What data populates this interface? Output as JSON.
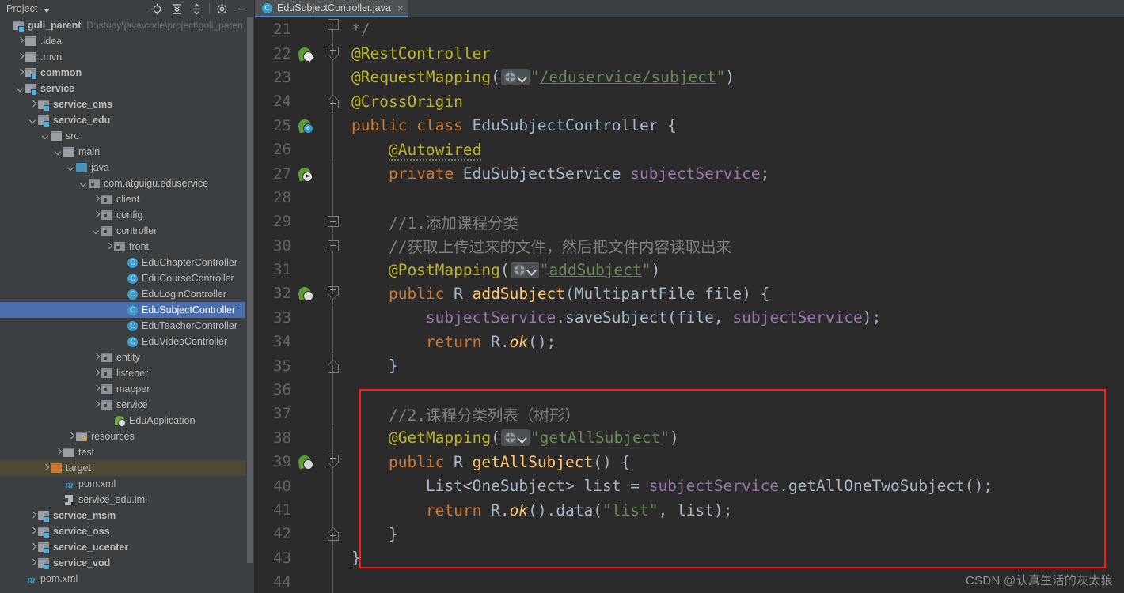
{
  "panel": {
    "title": "Project",
    "toolbar": [
      {
        "name": "locate-icon",
        "label": "Select Opened File"
      },
      {
        "name": "expand-all-icon",
        "label": "Expand All"
      },
      {
        "name": "collapse-all-icon",
        "label": "Collapse All"
      },
      {
        "name": "gear-icon",
        "label": "Settings"
      },
      {
        "name": "minimize-icon",
        "label": "Hide"
      }
    ],
    "tree": [
      {
        "label": "guli_parent",
        "path": "D:\\study\\java\\code\\project\\guli_paren",
        "indent": 0,
        "arrow": "none",
        "icon": "module",
        "bold": true,
        "state": "normal"
      },
      {
        "label": ".idea",
        "indent": 1,
        "arrow": "right",
        "icon": "folder",
        "bold": false,
        "state": "normal"
      },
      {
        "label": ".mvn",
        "indent": 1,
        "arrow": "right",
        "icon": "folder",
        "bold": false,
        "state": "normal"
      },
      {
        "label": "common",
        "indent": 1,
        "arrow": "right",
        "icon": "module",
        "bold": true,
        "state": "normal"
      },
      {
        "label": "service",
        "indent": 1,
        "arrow": "down",
        "icon": "module",
        "bold": true,
        "state": "normal"
      },
      {
        "label": "service_cms",
        "indent": 2,
        "arrow": "right",
        "icon": "module",
        "bold": true,
        "state": "normal"
      },
      {
        "label": "service_edu",
        "indent": 2,
        "arrow": "down",
        "icon": "module",
        "bold": true,
        "state": "normal"
      },
      {
        "label": "src",
        "indent": 3,
        "arrow": "down",
        "icon": "src",
        "bold": false,
        "state": "normal"
      },
      {
        "label": "main",
        "indent": 4,
        "arrow": "down",
        "icon": "folder",
        "bold": false,
        "state": "normal"
      },
      {
        "label": "java",
        "indent": 5,
        "arrow": "down",
        "icon": "javafolder",
        "bold": false,
        "state": "normal"
      },
      {
        "label": "com.atguigu.eduservice",
        "indent": 6,
        "arrow": "down",
        "icon": "pkg",
        "bold": false,
        "state": "normal"
      },
      {
        "label": "client",
        "indent": 7,
        "arrow": "right",
        "icon": "pkg",
        "bold": false,
        "state": "normal"
      },
      {
        "label": "config",
        "indent": 7,
        "arrow": "right",
        "icon": "pkg",
        "bold": false,
        "state": "normal"
      },
      {
        "label": "controller",
        "indent": 7,
        "arrow": "down",
        "icon": "pkg",
        "bold": false,
        "state": "normal"
      },
      {
        "label": "front",
        "indent": 8,
        "arrow": "right",
        "icon": "pkg",
        "bold": false,
        "state": "normal"
      },
      {
        "label": "EduChapterController",
        "indent": 9,
        "arrow": "none",
        "icon": "class",
        "bold": false,
        "state": "normal"
      },
      {
        "label": "EduCourseController",
        "indent": 9,
        "arrow": "none",
        "icon": "class",
        "bold": false,
        "state": "normal"
      },
      {
        "label": "EduLoginController",
        "indent": 9,
        "arrow": "none",
        "icon": "class",
        "bold": false,
        "state": "normal"
      },
      {
        "label": "EduSubjectController",
        "indent": 9,
        "arrow": "none",
        "icon": "class",
        "bold": false,
        "state": "selected"
      },
      {
        "label": "EduTeacherController",
        "indent": 9,
        "arrow": "none",
        "icon": "class",
        "bold": false,
        "state": "normal"
      },
      {
        "label": "EduVideoController",
        "indent": 9,
        "arrow": "none",
        "icon": "class",
        "bold": false,
        "state": "normal"
      },
      {
        "label": "entity",
        "indent": 7,
        "arrow": "right",
        "icon": "pkg",
        "bold": false,
        "state": "normal"
      },
      {
        "label": "listener",
        "indent": 7,
        "arrow": "right",
        "icon": "pkg",
        "bold": false,
        "state": "normal"
      },
      {
        "label": "mapper",
        "indent": 7,
        "arrow": "right",
        "icon": "pkg",
        "bold": false,
        "state": "normal"
      },
      {
        "label": "service",
        "indent": 7,
        "arrow": "right",
        "icon": "pkg",
        "bold": false,
        "state": "normal"
      },
      {
        "label": "EduApplication",
        "indent": 8,
        "arrow": "none",
        "icon": "spring",
        "bold": false,
        "state": "normal"
      },
      {
        "label": "resources",
        "indent": 5,
        "arrow": "right",
        "icon": "res",
        "bold": false,
        "state": "normal"
      },
      {
        "label": "test",
        "indent": 4,
        "arrow": "right",
        "icon": "folder",
        "bold": false,
        "state": "normal"
      },
      {
        "label": "target",
        "indent": 3,
        "arrow": "right",
        "icon": "target",
        "bold": false,
        "state": "highlighted"
      },
      {
        "label": "pom.xml",
        "indent": 4,
        "arrow": "none",
        "icon": "maven",
        "bold": false,
        "state": "normal"
      },
      {
        "label": "service_edu.iml",
        "indent": 4,
        "arrow": "none",
        "icon": "iml",
        "bold": false,
        "state": "normal"
      },
      {
        "label": "service_msm",
        "indent": 2,
        "arrow": "right",
        "icon": "module",
        "bold": true,
        "state": "normal"
      },
      {
        "label": "service_oss",
        "indent": 2,
        "arrow": "right",
        "icon": "module",
        "bold": true,
        "state": "normal"
      },
      {
        "label": "service_ucenter",
        "indent": 2,
        "arrow": "right",
        "icon": "module",
        "bold": true,
        "state": "normal"
      },
      {
        "label": "service_vod",
        "indent": 2,
        "arrow": "right",
        "icon": "module",
        "bold": true,
        "state": "normal"
      },
      {
        "label": "pom.xml",
        "indent": 1,
        "arrow": "none",
        "icon": "maven",
        "bold": false,
        "state": "normal"
      }
    ]
  },
  "editor": {
    "tab": {
      "label": "EduSubjectController.java",
      "close": "×",
      "icon": "java-class-icon"
    },
    "lines": [
      {
        "no": "21",
        "gutter": "none",
        "fold": "fold-start-top",
        "html": "<span class=\"cmt\">*/</span>"
      },
      {
        "no": "22",
        "gutter": "bean-check",
        "fold": "fold-arrow-down",
        "html": "<span class=\"ann\">@RestController</span>"
      },
      {
        "no": "23",
        "gutter": "none",
        "fold": "none",
        "html": "<span class=\"ann\">@RequestMapping</span><span class=\"punc\">(</span><WEB><span class=\"str\">\"</span><span class=\"ul-link\">/eduservice/subject</span><span class=\"str\">\"</span><span class=\"punc\">)</span>"
      },
      {
        "no": "24",
        "gutter": "none",
        "fold": "fold-arrow-up",
        "html": "<span class=\"ann\">@CrossOrigin</span>"
      },
      {
        "no": "25",
        "gutter": "bean-blue",
        "fold": "none",
        "html": "<span class=\"kw\">public class </span><span class=\"cls\">EduSubjectController </span><span class=\"punc\">{</span>"
      },
      {
        "no": "26",
        "gutter": "none",
        "fold": "none",
        "html": "    <span class=\"ann wavy\">@Autowired</span>"
      },
      {
        "no": "27",
        "gutter": "bean-arrow",
        "fold": "none",
        "html": "    <span class=\"kw\">private </span><span class=\"cls\">EduSubjectService </span><span class=\"field\">subjectService</span><span class=\"punc\">;</span>"
      },
      {
        "no": "28",
        "gutter": "none",
        "fold": "none",
        "html": ""
      },
      {
        "no": "29",
        "gutter": "none",
        "fold": "fold-box-small",
        "html": "    <span class=\"cmt\">//1.添加课程分类</span>"
      },
      {
        "no": "30",
        "gutter": "none",
        "fold": "fold-box-small",
        "html": "    <span class=\"cmt\">//获取上传过来的文件，然后把文件内容读取出来</span>"
      },
      {
        "no": "31",
        "gutter": "none",
        "fold": "none",
        "html": "    <span class=\"ann\">@PostMapping</span><span class=\"punc\">(</span><WEB><span class=\"str\">\"</span><span class=\"ul-link\">addSubject</span><span class=\"str\">\"</span><span class=\"punc\">)</span>"
      },
      {
        "no": "32",
        "gutter": "bean-web",
        "fold": "fold-arrow-down",
        "html": "    <span class=\"kw\">public </span><span class=\"cls\">R </span><span class=\"fn\">addSubject</span><span class=\"punc\">(</span><span class=\"cls\">MultipartFile </span><span class=\"punc\">file) {</span>"
      },
      {
        "no": "33",
        "gutter": "none",
        "fold": "none",
        "html": "        <span class=\"field\">subjectService</span><span class=\"punc\">.</span><span class=\"punc\">saveSubject(</span><span class=\"punc\">file, </span><span class=\"field\">subjectService</span><span class=\"punc\">);</span>"
      },
      {
        "no": "34",
        "gutter": "none",
        "fold": "none",
        "html": "        <span class=\"kw\">return </span><span class=\"cls\">R.</span><span class=\"fn ital\">ok</span><span class=\"punc\">();</span>"
      },
      {
        "no": "35",
        "gutter": "none",
        "fold": "fold-arrow-up",
        "html": "    <span class=\"punc\">}</span>"
      },
      {
        "no": "36",
        "gutter": "none",
        "fold": "none",
        "html": ""
      },
      {
        "no": "37",
        "gutter": "none",
        "fold": "none",
        "html": "    <span class=\"cmt\">//2.课程分类列表（树形）</span>"
      },
      {
        "no": "38",
        "gutter": "none",
        "fold": "none",
        "html": "    <span class=\"ann\">@GetMapping</span><span class=\"punc\">(</span><WEB><span class=\"str\">\"</span><span class=\"ul-link\">getAllSubject</span><span class=\"str\">\"</span><span class=\"punc\">)</span>"
      },
      {
        "no": "39",
        "gutter": "bean-web",
        "fold": "fold-arrow-down",
        "html": "    <span class=\"kw\">public </span><span class=\"cls\">R </span><span class=\"fn\">getAllSubject</span><span class=\"punc\">() {</span>"
      },
      {
        "no": "40",
        "gutter": "none",
        "fold": "none",
        "html": "        <span class=\"cls\">List&lt;OneSubject&gt; </span><span class=\"punc\">list = </span><span class=\"field\">subjectService</span><span class=\"punc\">.</span><span class=\"punc\">getAllOneTwoSubject();</span>"
      },
      {
        "no": "41",
        "gutter": "none",
        "fold": "none",
        "html": "        <span class=\"kw\">return </span><span class=\"cls\">R.</span><span class=\"fn ital\">ok</span><span class=\"punc\">().</span><span class=\"punc\">data(</span><span class=\"str\">\"list\"</span><span class=\"punc\">, list);</span>"
      },
      {
        "no": "42",
        "gutter": "none",
        "fold": "fold-arrow-up",
        "html": "    <span class=\"punc\">}</span>"
      },
      {
        "no": "43",
        "gutter": "none",
        "fold": "none",
        "html": "<span class=\"punc\">}</span>"
      },
      {
        "no": "44",
        "gutter": "none",
        "fold": "none",
        "html": ""
      }
    ]
  },
  "annotation": {
    "redbox_label": "highlighted-code-region"
  },
  "watermark": {
    "text": "CSDN @认真生活的灰太狼"
  },
  "colors": {
    "panel_bg": "#3c3f41",
    "editor_bg": "#2b2b2b",
    "selection_blue": "#4b6eaf",
    "highlight_brown": "#4e4935",
    "annotation_yellow": "#bbb529",
    "keyword_orange": "#cc7832",
    "string_green": "#6a8759",
    "method_yellow": "#ffc66d",
    "field_purple": "#9876aa",
    "comment_gray": "#808080",
    "redbox": "#ff1a1a",
    "tab_underline": "#4a88c7"
  }
}
